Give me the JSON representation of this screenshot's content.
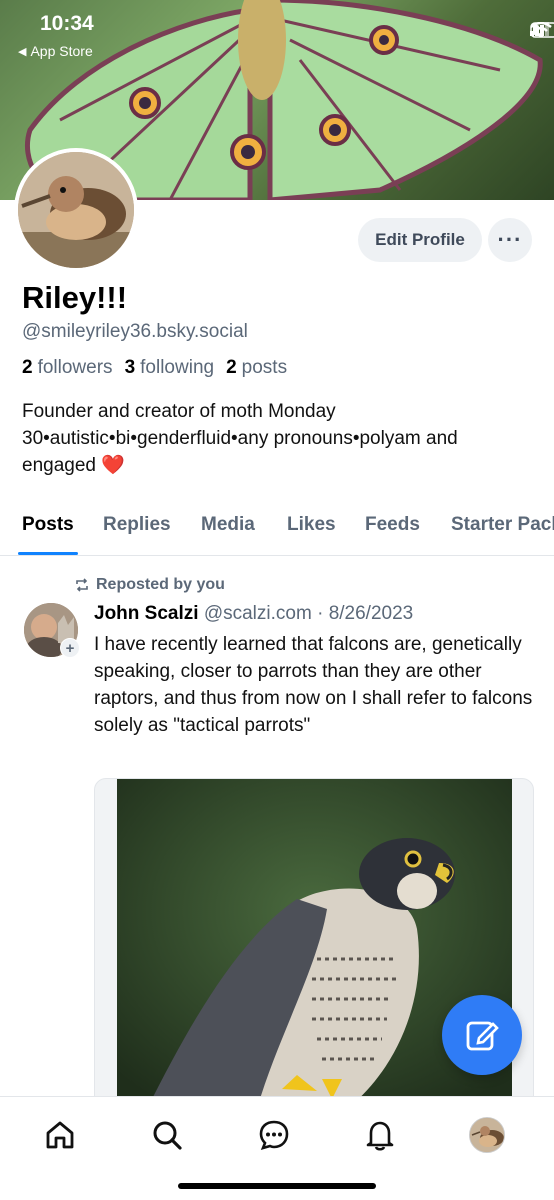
{
  "status_bar": {
    "time": "10:34",
    "back_label": "App Store"
  },
  "profile": {
    "display_name": "Riley!!!",
    "handle": "@smileyriley36.bsky.social",
    "followers_count": "2",
    "followers_label": "followers",
    "following_count": "3",
    "following_label": "following",
    "posts_count": "2",
    "posts_label": "posts",
    "bio": "Founder and creator of moth Monday 30•autistic•bi•genderfluid•any pronouns•polyam and engaged ❤️",
    "edit_label": "Edit Profile",
    "more_label": "···"
  },
  "tabs": [
    {
      "label": "Posts",
      "active": true
    },
    {
      "label": "Replies",
      "active": false
    },
    {
      "label": "Media",
      "active": false
    },
    {
      "label": "Likes",
      "active": false
    },
    {
      "label": "Feeds",
      "active": false
    },
    {
      "label": "Starter Packs",
      "active": false
    }
  ],
  "post": {
    "repost_label": "Reposted by you",
    "author_name": "John Scalzi",
    "author_handle": "@scalzi.com",
    "separator": "·",
    "date": "8/26/2023",
    "text": "I have recently learned that falcons are, genetically speaking, closer to parrots than they are other raptors, and thus from now on I shall refer to falcons solely as \"tactical parrots\""
  },
  "colors": {
    "accent": "#1083fe",
    "fab": "#2f7cf6",
    "secondary_text": "#5b6878",
    "button_bg": "#eef1f4"
  },
  "icons": {
    "fab": "compose-icon",
    "nav": [
      "home-icon",
      "search-icon",
      "chat-icon",
      "bell-icon",
      "profile-avatar"
    ]
  }
}
